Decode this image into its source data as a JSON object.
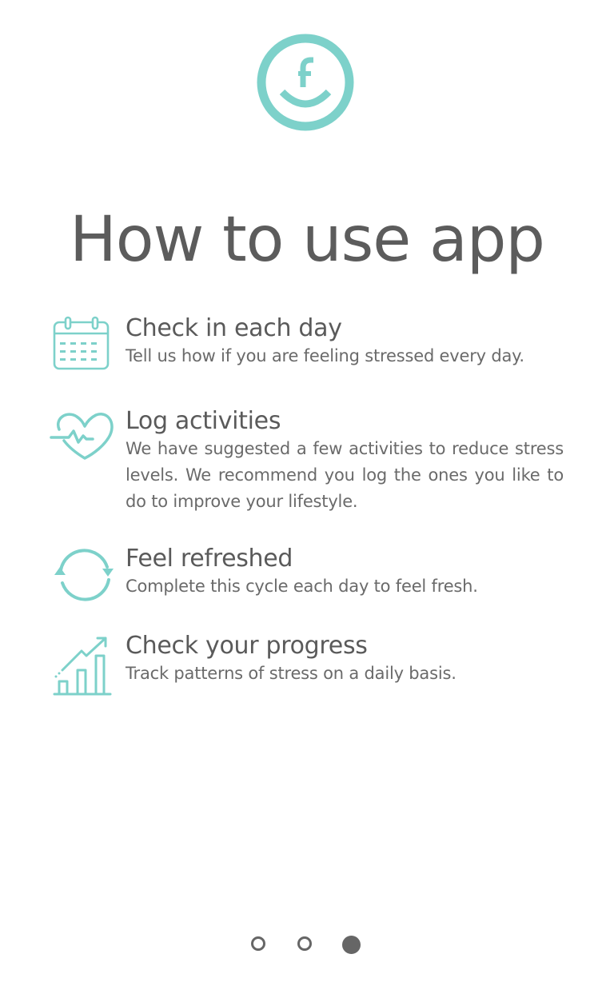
{
  "brand": {
    "logo_icon": "smiley-f-logo",
    "accent_color": "#7dd1ca"
  },
  "title": "How to use app",
  "features": [
    {
      "icon": "calendar-icon",
      "heading": "Check in each day",
      "description": "Tell us how if you are feeling stressed every day."
    },
    {
      "icon": "heart-pulse-icon",
      "heading": "Log activities",
      "description": "We have suggested a few activities to reduce stress levels. We recommend you log the ones you like to do to improve your lifestyle."
    },
    {
      "icon": "refresh-cycle-icon",
      "heading": "Feel refreshed",
      "description": "Complete this cycle each day to feel fresh."
    },
    {
      "icon": "progress-chart-icon",
      "heading": "Check your progress",
      "description": "Track patterns of stress on a daily basis."
    }
  ],
  "pagination": {
    "total": 3,
    "current": 3
  }
}
